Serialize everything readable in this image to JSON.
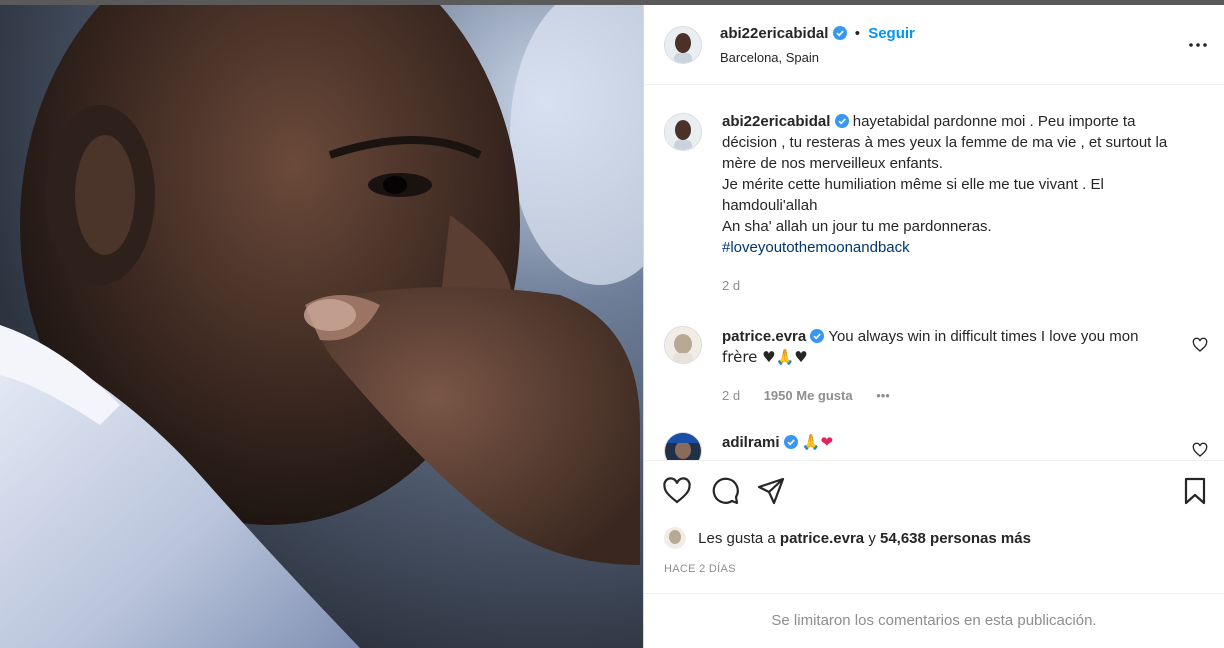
{
  "post": {
    "author": "abi22ericabidal",
    "follow_label": "Seguir",
    "location": "Barcelona, Spain",
    "caption": {
      "author": "abi22ericabidal",
      "lines": [
        "hayetabidal pardonne moi . Peu importe ta",
        "décision , tu resteras à mes yeux la femme de ma vie , et surtout la",
        "mère de nos merveilleux enfants.",
        "Je mérite cette humiliation même si elle me tue vivant . El",
        "hamdouli'allah",
        "An sha' allah un jour tu me pardonneras."
      ],
      "hashtag": "#loveyoutothemoonandback",
      "time": "2 d"
    },
    "comments": [
      {
        "author": "patrice.evra",
        "line1": "You always win in difficult times I love you mon",
        "line2": "frère ♥🙏♥",
        "time": "2 d",
        "likes": "1950 Me gusta",
        "more": "•••"
      },
      {
        "author": "adilrami",
        "text": "🙏❤"
      }
    ],
    "liked_by": {
      "prefix": "Les gusta a",
      "user": "patrice.evra",
      "middle": "y",
      "others": "54,638 personas más"
    },
    "posted_ago": "HACE 2 DÍAS",
    "comments_limited": "Se limitaron los comentarios en esta publicación."
  },
  "colors": {
    "accent": "#0095f6",
    "verified": "#3897f0",
    "hashtag": "#00376b",
    "secondary_text": "#8e8e8e",
    "border": "#dbdbdb"
  },
  "icons": [
    "verified-badge-icon",
    "more-options-icon",
    "heart-icon",
    "comment-icon",
    "share-icon",
    "bookmark-icon"
  ]
}
